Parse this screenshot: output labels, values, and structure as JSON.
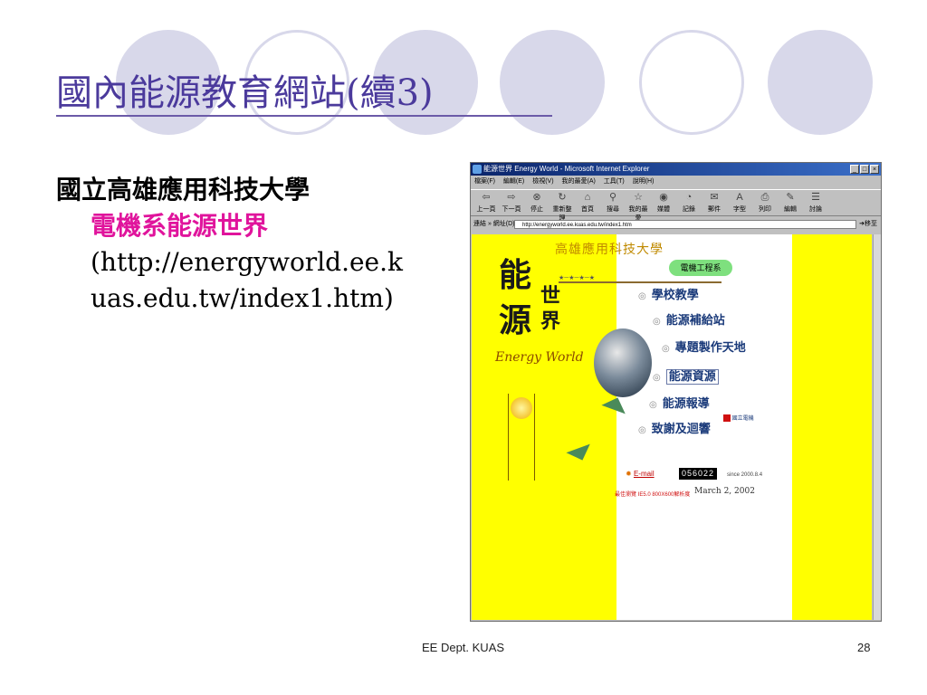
{
  "slide": {
    "title": "國內能源教育網站(續3)",
    "lines": [
      "國立高雄應用科技大學",
      "電機系能源世界",
      "(http://energyworld.ee.k",
      "uas.edu.tw/index1.htm)"
    ],
    "footer_center": "EE Dept. KUAS",
    "page_number": "28"
  },
  "colors": {
    "title": "#4b3a9c",
    "highlight": "#e0149c",
    "circle": "#d8d8ea",
    "site_yellow": "#ffff00"
  },
  "browser": {
    "window_title": "能源世界 Energy World - Microsoft Internet Explorer",
    "menu": [
      "檔案(F)",
      "編輯(E)",
      "檢視(V)",
      "我的最愛(A)",
      "工具(T)",
      "說明(H)"
    ],
    "toolbar": [
      {
        "icon": "back-arrow-icon",
        "label": "上一頁"
      },
      {
        "icon": "forward-arrow-icon",
        "label": "下一頁"
      },
      {
        "icon": "stop-icon",
        "label": "停止"
      },
      {
        "icon": "refresh-icon",
        "label": "重新整理"
      },
      {
        "icon": "home-icon",
        "label": "首頁"
      },
      {
        "icon": "search-icon",
        "label": "搜尋"
      },
      {
        "icon": "favorites-icon",
        "label": "我的最愛"
      },
      {
        "icon": "media-icon",
        "label": "媒體"
      },
      {
        "icon": "history-icon",
        "label": "記錄"
      },
      {
        "icon": "mail-icon",
        "label": "郵件"
      },
      {
        "icon": "font-icon",
        "label": "字型"
      },
      {
        "icon": "print-icon",
        "label": "列印"
      },
      {
        "icon": "edit-icon",
        "label": "編輯"
      },
      {
        "icon": "discuss-icon",
        "label": "討論"
      }
    ],
    "address_label": "連結 » 網址(D)",
    "address_value": "http://energyworld.ee.kuas.edu.tw/index1.htm",
    "go_label": "移至",
    "page": {
      "logo_chars": [
        "能",
        "源",
        "世",
        "界"
      ],
      "logo_english": "Energy World",
      "school_name": "高雄應用科技大學",
      "dept_badge": "電機工程系",
      "nav": [
        "學校教學",
        "能源補給站",
        "專題製作天地",
        "能源資源",
        "能源報導",
        "致謝及迴響"
      ],
      "side_link": "國立電機",
      "email_label": "E-mail",
      "counter": "056022",
      "since": "since 2000.8.4",
      "best_view": "最佳瀏覽 IE5.0 800X600解析度",
      "date": "March 2, 2002"
    }
  }
}
